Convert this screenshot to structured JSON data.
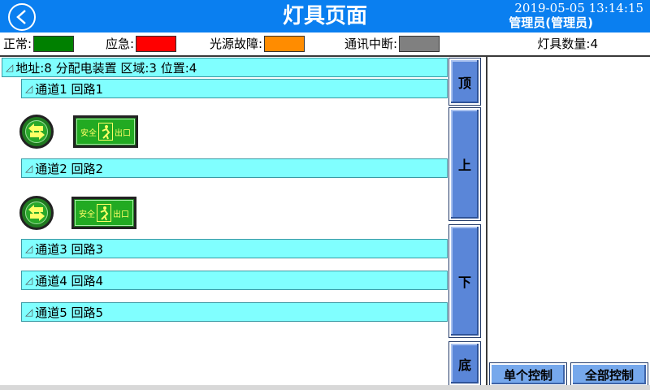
{
  "header": {
    "title": "灯具页面",
    "datetime": "2019-05-05  13:14:15",
    "user": "管理员(管理员)"
  },
  "legend": {
    "items": [
      {
        "label": "正常:",
        "color": "#008000"
      },
      {
        "label": "应急:",
        "color": "#ff0000"
      },
      {
        "label": "光源故障:",
        "color": "#ff8c00"
      },
      {
        "label": "通讯中断:",
        "color": "#808080"
      }
    ],
    "count_label": "灯具数量:4"
  },
  "tree": {
    "root_label": "地址:8 分配电装置 区域:3 位置:4",
    "channels": [
      {
        "label": "通道1  回路1"
      },
      {
        "label": "通道2  回路2"
      },
      {
        "label": "通道3  回路3"
      },
      {
        "label": "通道4  回路4"
      },
      {
        "label": "通道5  回路5"
      }
    ],
    "exit_sign_text_left": "安全",
    "exit_sign_text_right": "出口"
  },
  "nav": {
    "top": "顶",
    "up": "上",
    "down": "下",
    "bottom": "底"
  },
  "controls": {
    "single": "单个控制",
    "all": "全部控制"
  },
  "colors": {
    "header_bg": "#0a7ff0",
    "node_bg": "#80ffff",
    "button_bg": "#5a86d8"
  }
}
